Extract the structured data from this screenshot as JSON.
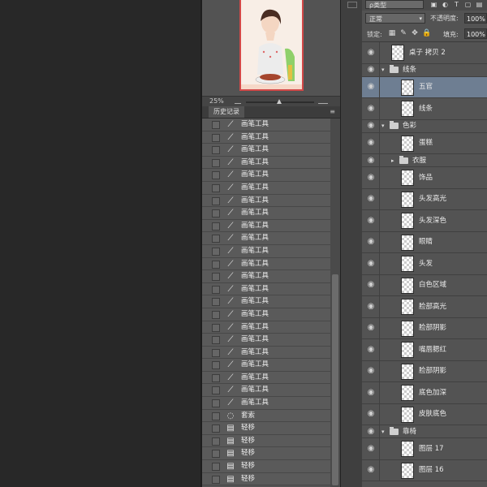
{
  "navigator": {
    "zoom": "25%"
  },
  "history": {
    "tab_label": "历史记录",
    "menu_icon": "≡",
    "items": [
      {
        "icon": "brush",
        "label": "画笔工具"
      },
      {
        "icon": "brush",
        "label": "画笔工具"
      },
      {
        "icon": "brush",
        "label": "画笔工具"
      },
      {
        "icon": "brush",
        "label": "画笔工具"
      },
      {
        "icon": "brush",
        "label": "画笔工具"
      },
      {
        "icon": "brush",
        "label": "画笔工具"
      },
      {
        "icon": "brush",
        "label": "画笔工具"
      },
      {
        "icon": "brush",
        "label": "画笔工具"
      },
      {
        "icon": "brush",
        "label": "画笔工具"
      },
      {
        "icon": "brush",
        "label": "画笔工具"
      },
      {
        "icon": "brush",
        "label": "画笔工具"
      },
      {
        "icon": "brush",
        "label": "画笔工具"
      },
      {
        "icon": "brush",
        "label": "画笔工具"
      },
      {
        "icon": "brush",
        "label": "画笔工具"
      },
      {
        "icon": "brush",
        "label": "画笔工具"
      },
      {
        "icon": "brush",
        "label": "画笔工具"
      },
      {
        "icon": "brush",
        "label": "画笔工具"
      },
      {
        "icon": "brush",
        "label": "画笔工具"
      },
      {
        "icon": "brush",
        "label": "画笔工具"
      },
      {
        "icon": "brush",
        "label": "画笔工具"
      },
      {
        "icon": "brush",
        "label": "画笔工具"
      },
      {
        "icon": "brush",
        "label": "画笔工具"
      },
      {
        "icon": "brush",
        "label": "画笔工具"
      },
      {
        "icon": "lasso",
        "label": "套索"
      },
      {
        "icon": "nudge",
        "label": "轻移"
      },
      {
        "icon": "nudge",
        "label": "轻移"
      },
      {
        "icon": "nudge",
        "label": "轻移"
      },
      {
        "icon": "nudge",
        "label": "轻移"
      },
      {
        "icon": "nudge",
        "label": "轻移"
      }
    ]
  },
  "layers_panel": {
    "kind_filter": "ρ类型",
    "blend_mode": "正常",
    "opacity_label": "不透明度:",
    "opacity_value": "100%",
    "lock_label": "锁定:",
    "fill_label": "填充:",
    "fill_value": "100%",
    "layers": [
      {
        "type": "layer",
        "name": "桌子 拷贝 2",
        "indent": 0,
        "selected": false
      },
      {
        "type": "group",
        "name": "线条",
        "indent": 0,
        "expanded": true
      },
      {
        "type": "layer",
        "name": "五官",
        "indent": 1,
        "selected": true
      },
      {
        "type": "layer",
        "name": "线条",
        "indent": 1,
        "selected": false
      },
      {
        "type": "group",
        "name": "色彩",
        "indent": 0,
        "expanded": true
      },
      {
        "type": "layer",
        "name": "蛋糕",
        "indent": 1,
        "selected": false
      },
      {
        "type": "group",
        "name": "衣服",
        "indent": 1,
        "expanded": false
      },
      {
        "type": "layer",
        "name": "饰品",
        "indent": 1,
        "selected": false
      },
      {
        "type": "layer",
        "name": "头发高光",
        "indent": 1,
        "selected": false
      },
      {
        "type": "layer",
        "name": "头发深色",
        "indent": 1,
        "selected": false
      },
      {
        "type": "layer",
        "name": "眼睛",
        "indent": 1,
        "selected": false
      },
      {
        "type": "layer",
        "name": "头发",
        "indent": 1,
        "selected": false
      },
      {
        "type": "layer",
        "name": "白色区域",
        "indent": 1,
        "selected": false
      },
      {
        "type": "layer",
        "name": "脸部高光",
        "indent": 1,
        "selected": false
      },
      {
        "type": "layer",
        "name": "脸部阴影",
        "indent": 1,
        "selected": false
      },
      {
        "type": "layer",
        "name": "嘴唇腮红",
        "indent": 1,
        "selected": false
      },
      {
        "type": "layer",
        "name": "脸部阴影",
        "indent": 1,
        "selected": false
      },
      {
        "type": "layer",
        "name": "底色加深",
        "indent": 1,
        "selected": false
      },
      {
        "type": "layer",
        "name": "皮肤底色",
        "indent": 1,
        "selected": false
      },
      {
        "type": "group",
        "name": "靠椅",
        "indent": 0,
        "expanded": true
      },
      {
        "type": "layer",
        "name": "图层 17",
        "indent": 1,
        "selected": false
      },
      {
        "type": "layer",
        "name": "图层 16",
        "indent": 1,
        "selected": false
      }
    ]
  }
}
